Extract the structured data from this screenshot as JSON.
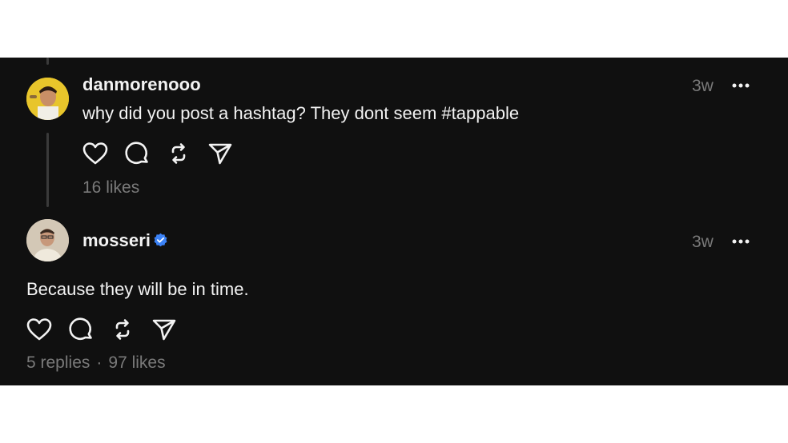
{
  "comment": {
    "username": "danmorenooo",
    "time": "3w",
    "text": "why did you post a hashtag? They dont seem #tappable",
    "likes": "16 likes"
  },
  "post": {
    "username": "mosseri",
    "verified": true,
    "time": "3w",
    "text": "Because they will be in time.",
    "replies": "5 replies",
    "separator": "·",
    "likes": "97 likes"
  },
  "colors": {
    "background": "#101010",
    "text": "#f3f3f3",
    "muted": "#7a7a7a",
    "verified_badge": "#3b82f6"
  },
  "icons": [
    "heart-icon",
    "comment-icon",
    "repost-icon",
    "send-icon",
    "more-icon",
    "verified-badge-icon"
  ]
}
